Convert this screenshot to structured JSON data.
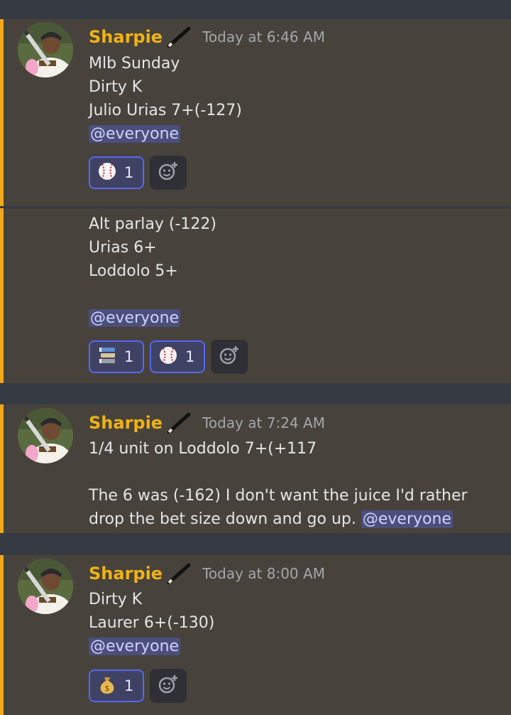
{
  "messages": [
    {
      "author": "Sharpie",
      "time": "Today at 6:46 AM",
      "lines": [
        "Mlb Sunday",
        "Dirty K",
        "Julio Urias 7+(-127)"
      ],
      "mention": "@everyone",
      "reactions": [
        {
          "icon": "baseball-icon",
          "count": "1"
        }
      ]
    },
    {
      "lines": [
        "Alt parlay (-122)",
        "Urias 6+",
        "Loddolo 5+"
      ],
      "mention": "@everyone",
      "reactions": [
        {
          "icon": "books-icon",
          "count": "1"
        },
        {
          "icon": "baseball-icon",
          "count": "1"
        }
      ]
    },
    {
      "author": "Sharpie",
      "time": "Today at 7:24 AM",
      "lines": [
        "1/4 unit on Loddolo 7+(+117",
        "The 6 was (-162) I don't want the juice I'd rather",
        "drop the bet size down and go up."
      ],
      "mention": "@everyone"
    },
    {
      "author": "Sharpie",
      "time": "Today at 8:00 AM",
      "lines": [
        "Dirty K",
        "Laurer 6+(-130)"
      ],
      "mention": "@everyone",
      "reactions": [
        {
          "icon": "money-bag-icon",
          "count": "1"
        }
      ]
    }
  ],
  "colors": {
    "background": "#363a43",
    "message_background": "#47433c",
    "highlight_bar": "#f2a71b",
    "username": "#f0b216",
    "mention_background": "#4c4e7c",
    "reaction_border": "#5865f2"
  }
}
